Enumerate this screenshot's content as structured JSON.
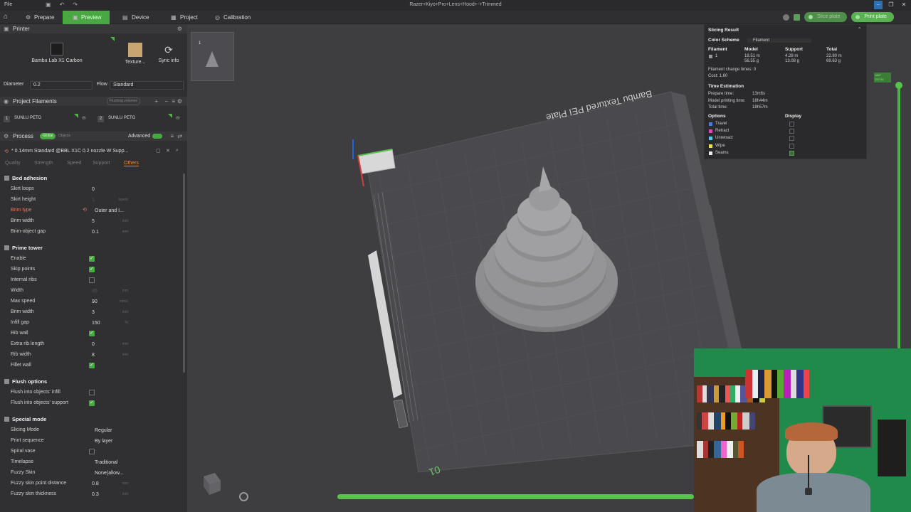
{
  "titlebar": {
    "menu": "File",
    "title": "Razer+Kiyo+Pro+Lens+Hood+-+Trimmed"
  },
  "nav": {
    "tabs": [
      {
        "label": "Prepare",
        "active": false
      },
      {
        "label": "Preview",
        "active": true
      },
      {
        "label": "Device",
        "active": false
      },
      {
        "label": "Project",
        "active": false
      },
      {
        "label": "Calibration",
        "active": false
      }
    ],
    "slice_plate": "Slice plate",
    "print_plate": "Print plate"
  },
  "printer": {
    "section_title": "Printer",
    "printer_name": "Bambu Lab X1 Carbon",
    "plate_name": "Texture...",
    "sync_label": "Sync info",
    "diameter_label": "Diameter",
    "diameter_value": "0.2",
    "flow_label": "Flow",
    "flow_value": "Standard"
  },
  "filaments": {
    "section_title": "Project Filaments",
    "flushing_label": "Flushing volumes",
    "items": [
      {
        "index": "1",
        "name": "SUNLU PETG"
      },
      {
        "index": "2",
        "name": "SUNLU PETG"
      }
    ]
  },
  "process": {
    "section_title": "Process",
    "global_label": "Global",
    "objects_label": "Objects",
    "advanced_label": "Advanced",
    "preset": "* 0.14mm Standard @BBL X1C 0.2 nozzle W Supp...",
    "tabs": [
      "Quality",
      "Strength",
      "Speed",
      "Support",
      "Others"
    ],
    "active_tab": "Others"
  },
  "params": {
    "bed_adhesion": "Bed adhesion",
    "skirt_loops": {
      "label": "Skirt loops",
      "value": "0"
    },
    "skirt_height": {
      "label": "Skirt height",
      "value": "1",
      "unit": "layers"
    },
    "brim_type": {
      "label": "Brim type",
      "value": "Outer and I..."
    },
    "brim_width": {
      "label": "Brim width",
      "value": "5",
      "unit": "mm"
    },
    "brim_gap": {
      "label": "Brim-object gap",
      "value": "0.1",
      "unit": "mm"
    },
    "prime_tower": "Prime tower",
    "enable": {
      "label": "Enable",
      "checked": true
    },
    "skip_points": {
      "label": "Skip points",
      "checked": true
    },
    "internal_ribs": {
      "label": "Internal ribs",
      "checked": false
    },
    "width": {
      "label": "Width",
      "value": "35",
      "unit": "mm"
    },
    "max_speed": {
      "label": "Max speed",
      "value": "90",
      "unit": "mm/s"
    },
    "pt_brim_width": {
      "label": "Brim width",
      "value": "3",
      "unit": "mm"
    },
    "infill_gap": {
      "label": "Infill gap",
      "value": "150",
      "unit": "%"
    },
    "rib_wall": {
      "label": "Rib wall",
      "checked": true
    },
    "extra_rib": {
      "label": "Extra rib length",
      "value": "0",
      "unit": "mm"
    },
    "rib_width": {
      "label": "Rib width",
      "value": "8",
      "unit": "mm"
    },
    "fillet_wall": {
      "label": "Fillet wall",
      "checked": true
    },
    "flush_options": "Flush options",
    "flush_infill": {
      "label": "Flush into objects' infill",
      "checked": false
    },
    "flush_support": {
      "label": "Flush into objects' support",
      "checked": true
    },
    "special_mode": "Special mode",
    "slicing_mode": {
      "label": "Slicing Mode",
      "value": "Regular"
    },
    "print_sequence": {
      "label": "Print sequence",
      "value": "By layer"
    },
    "spiral_vase": {
      "label": "Spiral vase",
      "checked": false
    },
    "timelapse": {
      "label": "Timelapse",
      "value": "Traditional"
    },
    "fuzzy_skin": {
      "label": "Fuzzy Skin",
      "value": "None(allow..."
    },
    "fuzzy_dist": {
      "label": "Fuzzy skin point distance",
      "value": "0.8",
      "unit": "mm"
    },
    "fuzzy_thick": {
      "label": "Fuzzy skin thickness",
      "value": "0.3",
      "unit": "mm"
    }
  },
  "plate": {
    "thumb_number": "1",
    "bed_label": "Bambu Textured PEI Plate",
    "plate_number": "01"
  },
  "result": {
    "title": "Slicing Result",
    "color_scheme_label": "Color Scheme",
    "color_scheme_value": "Filament",
    "headers": [
      "Filament",
      "Model",
      "Support",
      "Total"
    ],
    "row": {
      "filament": "1",
      "model_m": "18.51 m",
      "model_g": "56.55 g",
      "support_m": "4.28 m",
      "support_g": "13.08 g",
      "total_m": "22.80 m",
      "total_g": "69.63 g"
    },
    "change_times": "Filament change times:  0",
    "cost": "Cost:  1.60",
    "time_title": "Time Estimation",
    "prepare_time": "Prepare time:",
    "prepare_value": "13m6s",
    "model_time": "Model printing time:",
    "model_value": "18h44m",
    "total_time": "Total time:",
    "total_value": "18h57m",
    "options_label": "Options",
    "display_label": "Display",
    "options": [
      {
        "label": "Travel",
        "color": "#4d7bd6",
        "checked": false
      },
      {
        "label": "Retract",
        "color": "#d64db4",
        "checked": false
      },
      {
        "label": "Unretract",
        "color": "#63c6e6",
        "checked": false
      },
      {
        "label": "Wipe",
        "color": "#e6e24d",
        "checked": false
      },
      {
        "label": "Seams",
        "color": "#e8e8e8",
        "checked": true
      }
    ]
  },
  "layer_slider": {
    "top_label": "1867",
    "top_value": "152.34"
  },
  "colors": {
    "accent": "#4aa843",
    "panel": "#303032",
    "viewport": "#3e3e41"
  }
}
